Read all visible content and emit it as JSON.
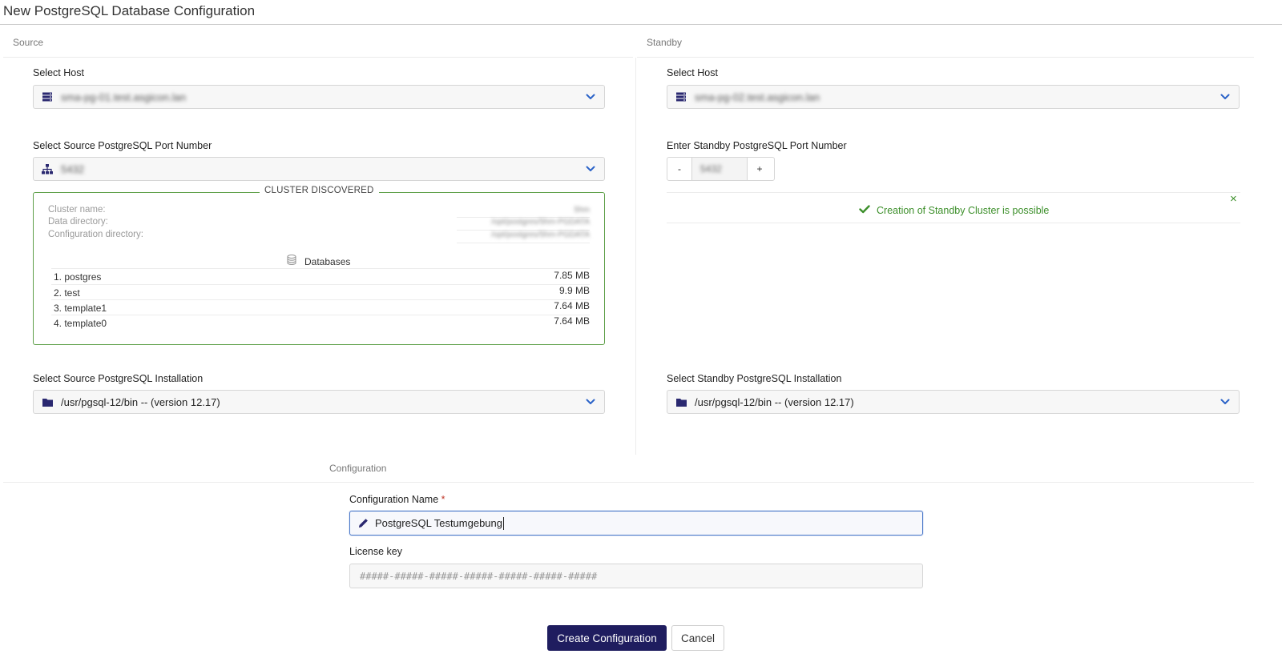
{
  "page": {
    "title": "New PostgreSQL Database Configuration"
  },
  "source": {
    "section_label": "Source",
    "host": {
      "label": "Select Host",
      "value": "sma-pg-01.test.asgicon.lan",
      "icon": "server-icon"
    },
    "port": {
      "label": "Select Source PostgreSQL Port Number",
      "value": "5432",
      "icon": "network-icon"
    },
    "cluster": {
      "legend": "CLUSTER DISCOVERED",
      "info": [
        {
          "label": "Cluster name:",
          "value": "5hm"
        },
        {
          "label": "Data directory:",
          "value": "/opt/postgres/5hm-PGDATA"
        },
        {
          "label": "Configuration directory:",
          "value": "/opt/postgres/5hm-PGDATA"
        }
      ],
      "databases_header": "Databases",
      "databases": [
        {
          "name": "1. postgres",
          "size": "7.85 MB"
        },
        {
          "name": "2. test",
          "size": "9.9 MB"
        },
        {
          "name": "3. template1",
          "size": "7.64 MB"
        },
        {
          "name": "4. template0",
          "size": "7.64 MB"
        }
      ]
    },
    "installation": {
      "label": "Select Source PostgreSQL Installation",
      "value": "/usr/pgsql-12/bin -- (version 12.17)"
    }
  },
  "standby": {
    "section_label": "Standby",
    "host": {
      "label": "Select Host",
      "value": "sma-pg-02.test.asgicon.lan"
    },
    "port": {
      "label": "Enter Standby PostgreSQL Port Number",
      "value": "5432",
      "minus": "-",
      "plus": "+"
    },
    "status": {
      "message": "Creation of Standby Cluster is possible",
      "close": "×"
    },
    "installation": {
      "label": "Select Standby PostgreSQL Installation",
      "value": "/usr/pgsql-12/bin -- (version 12.17)"
    }
  },
  "configuration": {
    "section_label": "Configuration",
    "name": {
      "label": "Configuration Name",
      "required": "*",
      "value": "PostgreSQL Testumgebung"
    },
    "license": {
      "label": "License key",
      "placeholder": "#####-#####-#####-#####-#####-#####-#####"
    }
  },
  "actions": {
    "create": "Create Configuration",
    "cancel": "Cancel"
  },
  "colors": {
    "primary": "#1f1d5f",
    "success": "#3c8f2a",
    "link_blue": "#2b63c8",
    "focus": "#4a78c9"
  }
}
